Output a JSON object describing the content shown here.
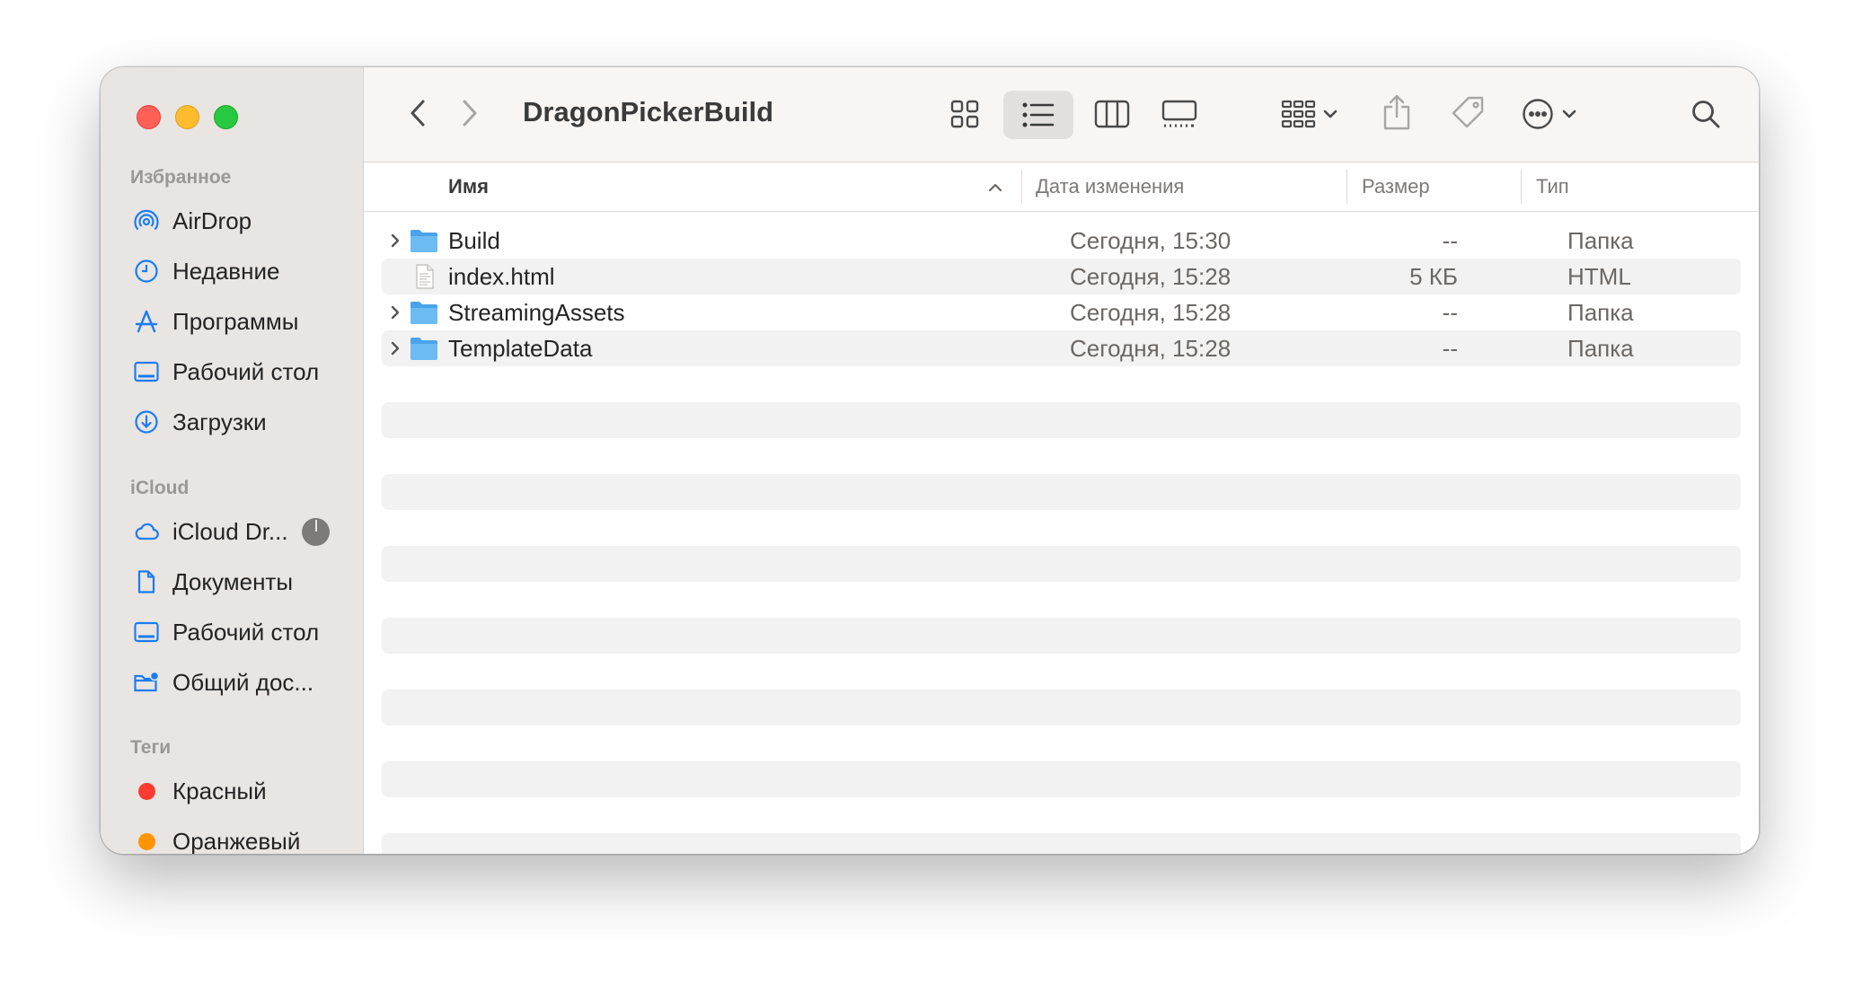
{
  "window": {
    "title": "DragonPickerBuild"
  },
  "sidebar": {
    "favorites_heading": "Избранное",
    "favorites": [
      {
        "label": "AirDrop",
        "icon": "airdrop-icon"
      },
      {
        "label": "Недавние",
        "icon": "clock-icon"
      },
      {
        "label": "Программы",
        "icon": "applications-icon"
      },
      {
        "label": "Рабочий стол",
        "icon": "desktop-icon"
      },
      {
        "label": "Загрузки",
        "icon": "download-icon"
      }
    ],
    "icloud_heading": "iCloud",
    "icloud": [
      {
        "label": "iCloud Dr...",
        "icon": "cloud-icon"
      },
      {
        "label": "Документы",
        "icon": "document-icon"
      },
      {
        "label": "Рабочий стол",
        "icon": "desktop-icon"
      },
      {
        "label": "Общий дос...",
        "icon": "shared-folder-icon"
      }
    ],
    "tags_heading": "Теги",
    "tags": [
      {
        "label": "Красный",
        "color": "#fe3b30"
      },
      {
        "label": "Оранжевый",
        "color": "#fe9500"
      }
    ]
  },
  "columns": {
    "name": "Имя",
    "date": "Дата изменения",
    "size": "Размер",
    "kind": "Тип"
  },
  "files": [
    {
      "name": "Build",
      "date": "Сегодня, 15:30",
      "size": "--",
      "kind": "Папка",
      "type": "folder"
    },
    {
      "name": "index.html",
      "date": "Сегодня, 15:28",
      "size": "5 КБ",
      "kind": "HTML",
      "type": "file"
    },
    {
      "name": "StreamingAssets",
      "date": "Сегодня, 15:28",
      "size": "--",
      "kind": "Папка",
      "type": "folder"
    },
    {
      "name": "TemplateData",
      "date": "Сегодня, 15:28",
      "size": "--",
      "kind": "Папка",
      "type": "folder"
    }
  ],
  "colors": {
    "accent": "#1a7cf5",
    "folder": "#5eb0ef"
  }
}
